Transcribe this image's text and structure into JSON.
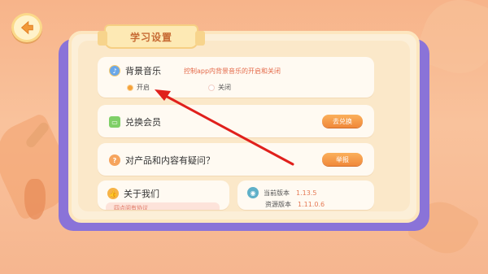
{
  "header": {
    "title": "学习设置"
  },
  "icons": {
    "back": "back-arrow-icon",
    "music": "music-note-icon",
    "redeem": "ticket-icon",
    "question": "question-mark-icon",
    "about": "thumbs-up-icon",
    "version": "globe-icon"
  },
  "colors": {
    "accent": "#f08a3a",
    "purple": "#8a73d8",
    "hint": "#e46a4a"
  },
  "music": {
    "label": "背景音乐",
    "hint": "控制app内背景音乐的开启和关闭",
    "on_label": "开启",
    "off_label": "关闭",
    "selected": "开启"
  },
  "redeem": {
    "label": "兑换会员",
    "button": "去兑换"
  },
  "feedback": {
    "label": "对产品和内容有疑问？",
    "button": "举报"
  },
  "about": {
    "label": "关于我们",
    "sub": "四点阅有协议"
  },
  "version": {
    "current_label": "当前版本",
    "current_value": "1.13.5",
    "resource_label": "资源版本",
    "resource_value": "1.11.0.6"
  }
}
